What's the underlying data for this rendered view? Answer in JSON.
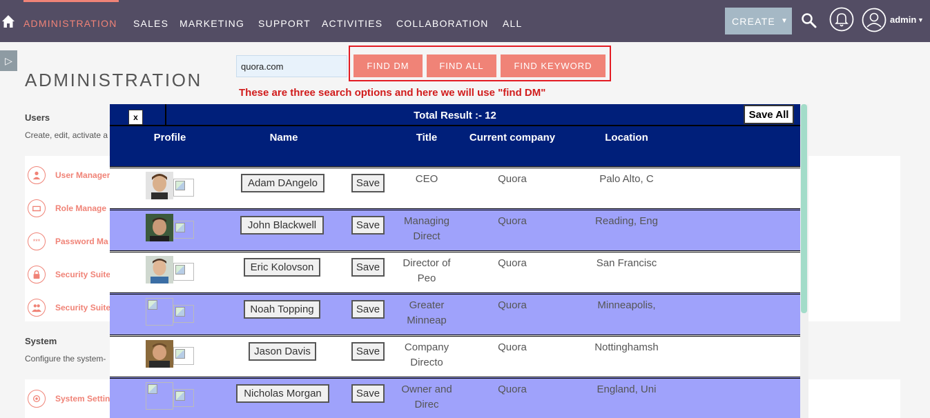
{
  "nav": {
    "items": [
      "ADMINISTRATION",
      "SALES",
      "MARKETING",
      "SUPPORT",
      "ACTIVITIES",
      "COLLABORATION",
      "ALL"
    ],
    "create_label": "CREATE",
    "user_label": "admin"
  },
  "page": {
    "title": "ADMINISTRATION"
  },
  "sections": {
    "users": {
      "heading": "Users",
      "description": "Create, edit, activate a",
      "links": [
        "User Manager",
        "Role Manage",
        "Password Ma",
        "Security Suite",
        "Security Suite"
      ]
    },
    "system": {
      "heading": "System",
      "description": "Configure the system-",
      "links": [
        "System Settin"
      ]
    }
  },
  "search": {
    "domain_value": "quora.com",
    "buttons": [
      "FIND DM",
      "FIND ALL",
      "FIND KEYWORD"
    ],
    "annotation": "These are three search options and here we will use \"find DM\""
  },
  "results": {
    "close_label": "x",
    "total_label": "Total Result :- 12",
    "save_all_label": "Save All",
    "columns": [
      "Profile",
      "Name",
      "Title",
      "Current company",
      "Location"
    ],
    "save_label": "Save",
    "rows": [
      {
        "name": "Adam DAngelo",
        "title": "CEO",
        "company": "Quora",
        "location": "Palo Alto, C",
        "has_photo": true
      },
      {
        "name": "John Blackwell",
        "title": "Managing Direct",
        "company": "Quora",
        "location": "Reading, Eng",
        "has_photo": true
      },
      {
        "name": "Eric Kolovson",
        "title": "Director of Peo",
        "company": "Quora",
        "location": "San Francisc",
        "has_photo": true
      },
      {
        "name": "Noah Topping",
        "title": "Greater Minneap",
        "company": "Quora",
        "location": "Minneapolis,",
        "has_photo": false
      },
      {
        "name": "Jason Davis",
        "title": "Company Directo",
        "company": "Quora",
        "location": "Nottinghamsh",
        "has_photo": true
      },
      {
        "name": "Nicholas Morgan",
        "title": "Owner and Direc",
        "company": "Quora",
        "location": "England, Uni",
        "has_photo": false
      }
    ]
  },
  "colors": {
    "nav_bg": "#534d64",
    "accent": "#f08377",
    "modal_header": "#001f7a",
    "row_alt": "#9fa2fb",
    "annotation": "#d11c1c"
  }
}
